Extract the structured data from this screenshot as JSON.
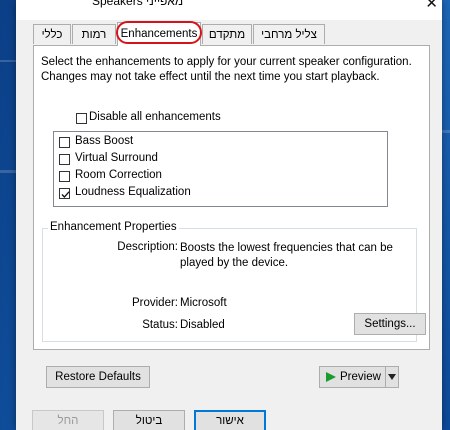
{
  "window": {
    "title": "מאפייני Speakers",
    "close_glyph": "✕"
  },
  "tabs": [
    {
      "label": "כללי"
    },
    {
      "label": "רמות"
    },
    {
      "label": "Enhancements"
    },
    {
      "label": "מתקדם"
    },
    {
      "label": "צליל מרחבי"
    }
  ],
  "active_tab": "Enhancements",
  "enhancements": {
    "description": "Select the enhancements to apply for your current speaker configuration. Changes may not take effect until the next time you start playback.",
    "disable_all_label": "Disable all enhancements",
    "disable_all_checked": false,
    "items": [
      {
        "label": "Bass Boost",
        "checked": false
      },
      {
        "label": "Virtual Surround",
        "checked": false
      },
      {
        "label": "Room Correction",
        "checked": false
      },
      {
        "label": "Loudness Equalization",
        "checked": true
      }
    ]
  },
  "properties": {
    "group_label": "Enhancement Properties",
    "description_label": "Description:",
    "description_value": "Boosts the lowest frequencies that can be played by the device.",
    "provider_label": "Provider:",
    "provider_value": "Microsoft",
    "status_label": "Status:",
    "status_value": "Disabled",
    "settings_button": "Settings..."
  },
  "footer": {
    "restore_defaults": "Restore Defaults",
    "preview": "Preview",
    "ok": "אישור",
    "cancel": "ביטול",
    "apply": "החל"
  },
  "colors": {
    "annotation_ring": "#d4141a",
    "focus_border": "#0078d7",
    "preview_arrow": "#1a9b2e"
  }
}
